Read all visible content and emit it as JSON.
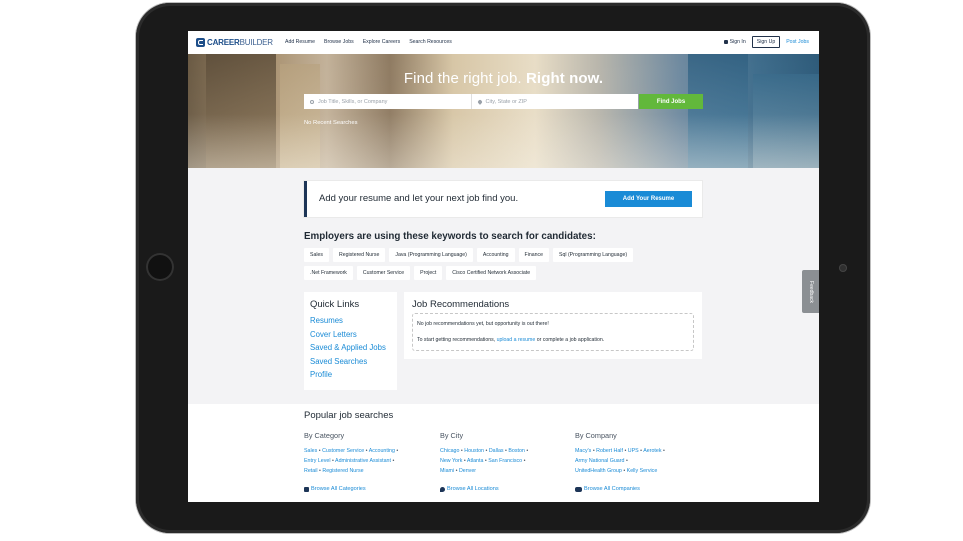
{
  "nav": {
    "logo_bold": "CAREER",
    "logo_light": "BUILDER",
    "links": [
      "Add Resume",
      "Browse Jobs",
      "Explore Careers",
      "Search Resources"
    ],
    "sign_in": "Sign In",
    "sign_up": "Sign Up",
    "post_jobs": "Post Jobs"
  },
  "hero": {
    "headline_light": "Find the right job.",
    "headline_bold": "Right now.",
    "keywords_placeholder": "Job Title, Skills, or Company",
    "location_placeholder": "City, State or ZIP",
    "find_jobs": "Find Jobs",
    "no_recent": "No Recent Searches"
  },
  "resume_card": {
    "text": "Add your resume and let your next job find you.",
    "button": "Add Your Resume"
  },
  "keywords": {
    "title": "Employers are using these keywords to search for candidates:",
    "items": [
      "Sales",
      "Registered Nurse",
      "Java (Programming Language)",
      "Accounting",
      "Finance",
      "Sql (Programming Language)",
      ".Net Framework",
      "Customer Service",
      "Project",
      "Cisco Certified Network Associate"
    ]
  },
  "quick_links": {
    "title": "Quick Links",
    "items": [
      "Resumes",
      "Cover Letters",
      "Saved & Applied Jobs",
      "Saved Searches",
      "Profile"
    ]
  },
  "job_recs": {
    "title": "Job Recommendations",
    "line1": "No job recommendations yet, but opportunity is out there!",
    "line2_pre": "To start getting recommendations,",
    "line2_link": "upload a resume",
    "line2_post": "or complete a job application."
  },
  "popular": {
    "title": "Popular job searches",
    "category": {
      "head": "By Category",
      "links": [
        "Sales",
        "Customer Service",
        "Accounting",
        "Entry Level",
        "Administrative Assistant",
        "Retail",
        "Registered Nurse"
      ],
      "browse": "Browse All Categories"
    },
    "city": {
      "head": "By City",
      "links": [
        "Chicago",
        "Houston",
        "Dallas",
        "Boston",
        "New York",
        "Atlanta",
        "San Francisco",
        "Miami",
        "Denver"
      ],
      "browse": "Browse All Locations"
    },
    "company": {
      "head": "By Company",
      "links": [
        "Macy's",
        "Robert Half",
        "UPS",
        "Aerotek",
        "Army National Guard",
        "UnitedHealth Group",
        "Kelly Service"
      ],
      "browse": "Browse All Companies"
    }
  },
  "feedback": "Feedback",
  "colors": {
    "accent": "#1a8bd6",
    "green": "#62b83b",
    "navy": "#1d3557"
  }
}
